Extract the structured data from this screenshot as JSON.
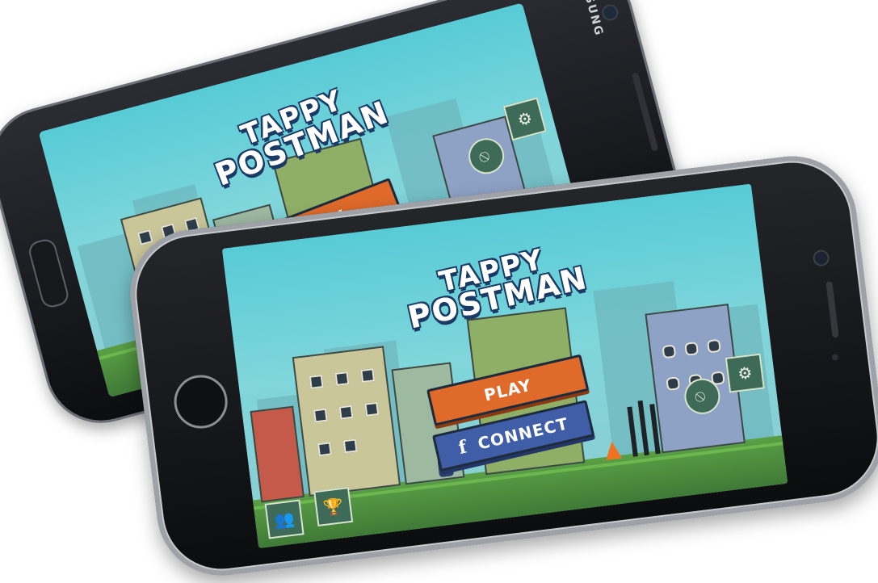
{
  "devices": [
    {
      "id": "samsung",
      "brand": "SAMSUNG"
    },
    {
      "id": "iphone"
    }
  ],
  "game": {
    "title_line1": "TAPPY",
    "title_line2": "POSTMAN",
    "play_label": "PLAY",
    "connect_label": "CONNECT",
    "facebook_glyph": "f",
    "icons": {
      "settings": "gear-icon",
      "ads_toggle": "no-ads-icon",
      "leaderboard": "trophy-icon",
      "friends": "people-icon"
    },
    "colors": {
      "sky": "#57cbd6",
      "play_button": "#e06a2a",
      "connect_button": "#3f5ea7",
      "grass": "#5a9f45",
      "title_outline": "#1b3a66"
    }
  }
}
